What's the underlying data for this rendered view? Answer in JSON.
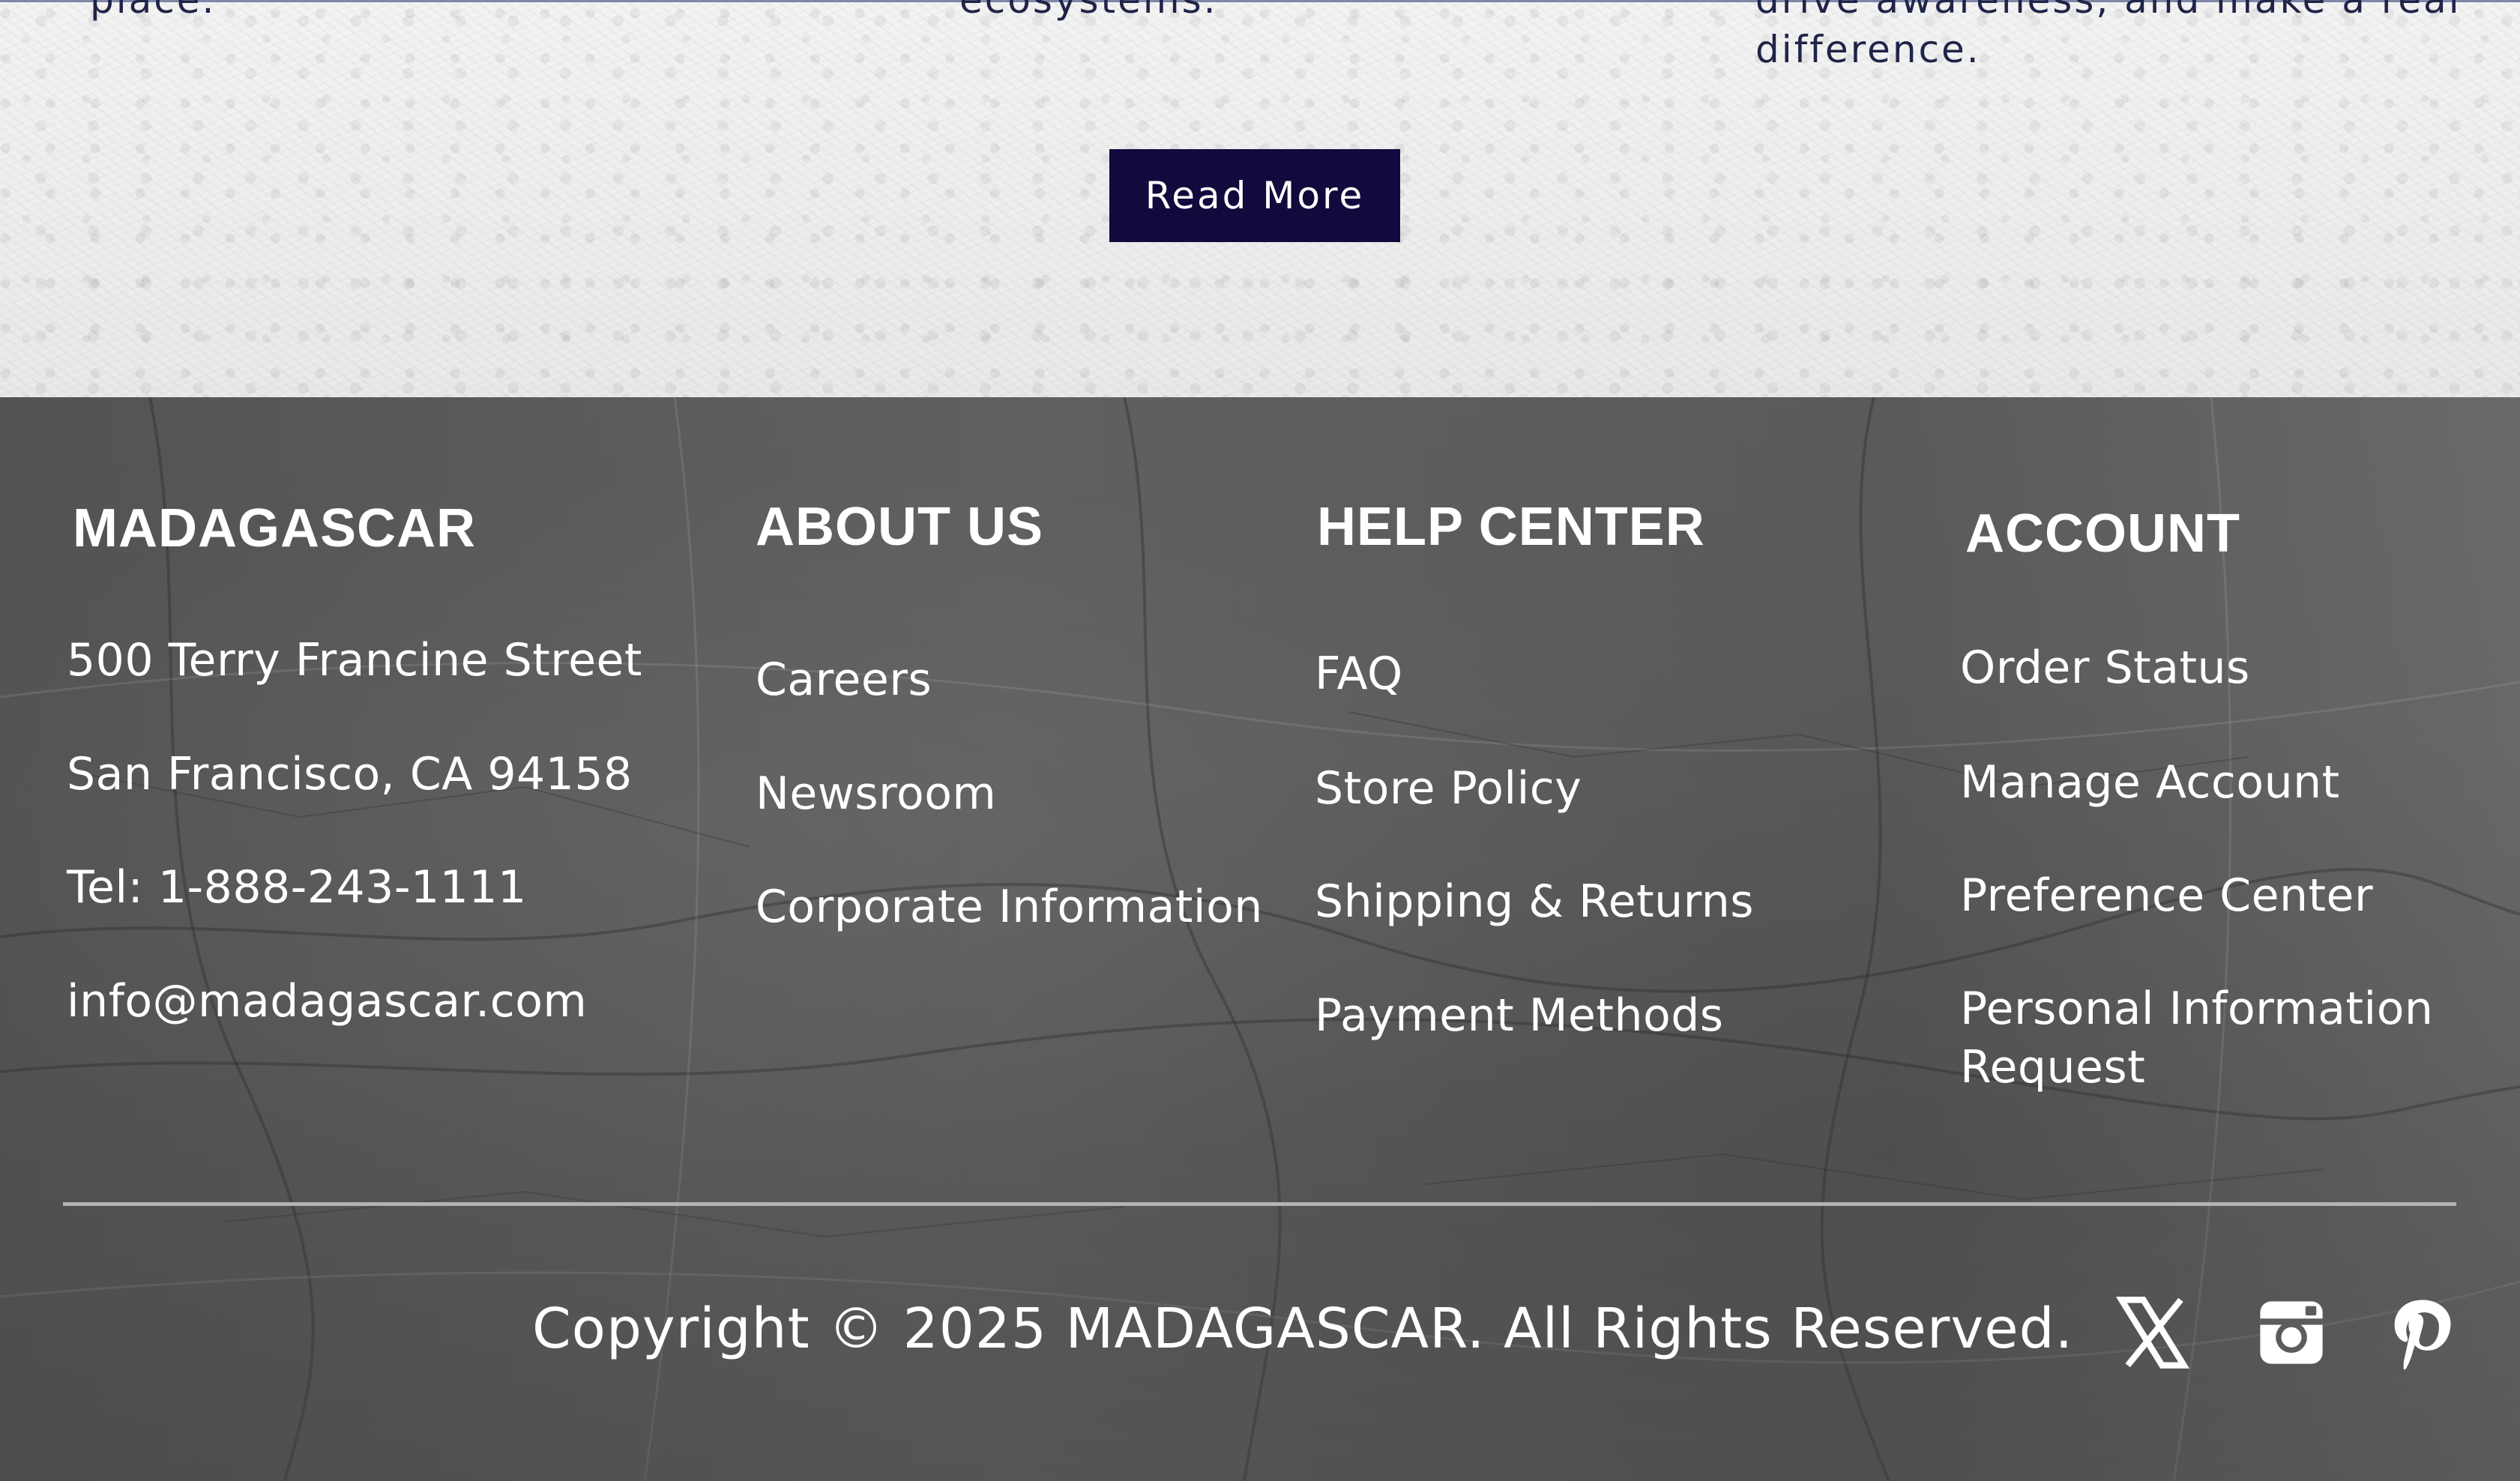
{
  "upper": {
    "snippets": [
      "place.",
      "ecosystems.",
      "drive awareness, and make a real",
      "difference."
    ],
    "read_more_label": "Read More"
  },
  "footer": {
    "brand": {
      "heading": "MADAGASCAR",
      "address_line_1": "500 Terry Francine Street",
      "address_line_2": "San Francisco, CA 94158",
      "phone": "Tel: 1-888-243-1111",
      "email": "info@madagascar.com"
    },
    "about": {
      "heading": "ABOUT US",
      "links": [
        "Careers",
        "Newsroom",
        "Corporate Information"
      ]
    },
    "help": {
      "heading": "HELP CENTER",
      "links": [
        "FAQ",
        "Store Policy",
        "Shipping & Returns",
        "Payment Methods"
      ]
    },
    "account": {
      "heading": "ACCOUNT",
      "links": [
        "Order Status",
        "Manage Account",
        "Preference Center",
        "Personal Information",
        "Request"
      ]
    },
    "copyright": "Copyright © 2025 MADAGASCAR. All Rights Reserved.",
    "social_icons": [
      "x-icon",
      "instagram-icon",
      "pinterest-icon"
    ]
  },
  "colors": {
    "button_bg": "#100a3d",
    "text_dark": "#1f2548",
    "footer_text": "#ffffff",
    "divider": "#b3b3b3"
  }
}
